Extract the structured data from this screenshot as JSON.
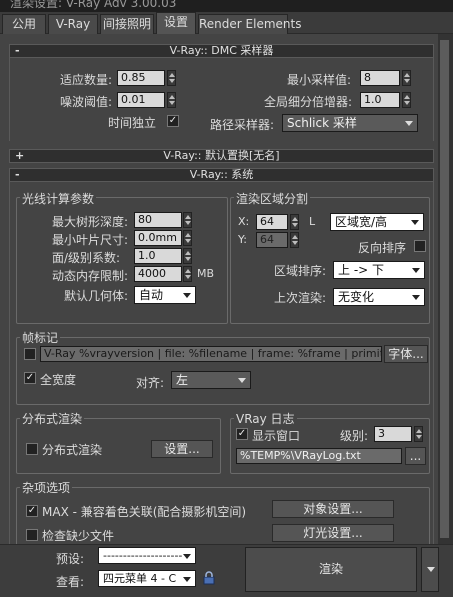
{
  "window": {
    "title": "渲染设置: V-Ray Adv 3.00.03"
  },
  "tabs": [
    {
      "label": "公用"
    },
    {
      "label": "V-Ray"
    },
    {
      "label": "间接照明"
    },
    {
      "label": "设置"
    },
    {
      "label": "Render Elements"
    }
  ],
  "dmc": {
    "header": "V-Ray:: DMC 采样器",
    "toggle": "-",
    "adaptive_amount_label": "适应数量:",
    "adaptive_amount": "0.85",
    "noise_threshold_label": "噪波阈值:",
    "noise_threshold": "0.01",
    "time_independent_label": "时间独立",
    "time_independent_checked": true,
    "min_samples_label": "最小采样值:",
    "min_samples": "8",
    "global_subdivs_label": "全局细分倍增器:",
    "global_subdivs": "1.0",
    "path_sampler_label": "路径采样器:",
    "path_sampler": "Schlick 采样"
  },
  "displacement": {
    "header": "V-Ray:: 默认置换[无名]",
    "toggle": "+"
  },
  "system": {
    "header": "V-Ray:: 系统",
    "toggle": "-",
    "raycast": {
      "title": "光线计算参数",
      "max_tree_depth_label": "最大树形深度:",
      "max_tree_depth": "80",
      "min_leaf_label": "最小叶片尺寸:",
      "min_leaf": "0.0mm",
      "face_level_label": "面/级别系数:",
      "face_level": "1.0",
      "mem_limit_label": "动态内存限制:",
      "mem_limit": "4000",
      "mem_unit": "MB",
      "default_geom_label": "默认几何体:",
      "default_geom": "自动"
    },
    "region": {
      "title": "渲染区域分割",
      "x_label": "X:",
      "x_value": "64",
      "y_label": "Y:",
      "y_value": "64",
      "lock_label": "L",
      "region_mode": "区域宽/高",
      "reverse_label": "反向排序",
      "reverse_checked": false,
      "sequence_label": "区域排序:",
      "sequence": "上 -> 下",
      "previous_label": "上次渲染:",
      "previous": "无变化"
    },
    "stamp": {
      "title": "帧标记",
      "enabled": false,
      "text": "V-Ray %vrayversion | file: %filename | frame: %frame | primitives: %",
      "font_button": "字体...",
      "full_width_label": "全宽度",
      "full_width_checked": true,
      "align_label": "对齐:",
      "align": "左"
    },
    "distributed": {
      "title": "分布式渲染",
      "enable_label": "分布式渲染",
      "enabled": false,
      "settings_button": "设置..."
    },
    "log": {
      "title": "VRay 日志",
      "show_window_label": "显示窗口",
      "show_window_checked": true,
      "level_label": "级别:",
      "level": "3",
      "path": "%TEMP%\\VRayLog.txt",
      "browse_button": "..."
    },
    "misc": {
      "title": "杂项选项",
      "max_compat_label": "MAX - 兼容着色关联(配合摄影机空间)",
      "max_compat_checked": true,
      "object_settings_button": "对象设置...",
      "check_missing_label": "检查缺少文件",
      "light_settings_button": "灯光设置..."
    }
  },
  "bottom": {
    "preset_label": "预设:",
    "preset": "--------------------",
    "view_label": "查看:",
    "view": "四元菜单 4 - C",
    "render_button": "渲染"
  },
  "colors": {
    "panel_bg": "#444444",
    "field_bg": "#d9d9d9",
    "rollup_bg": "#2f2f2f"
  }
}
